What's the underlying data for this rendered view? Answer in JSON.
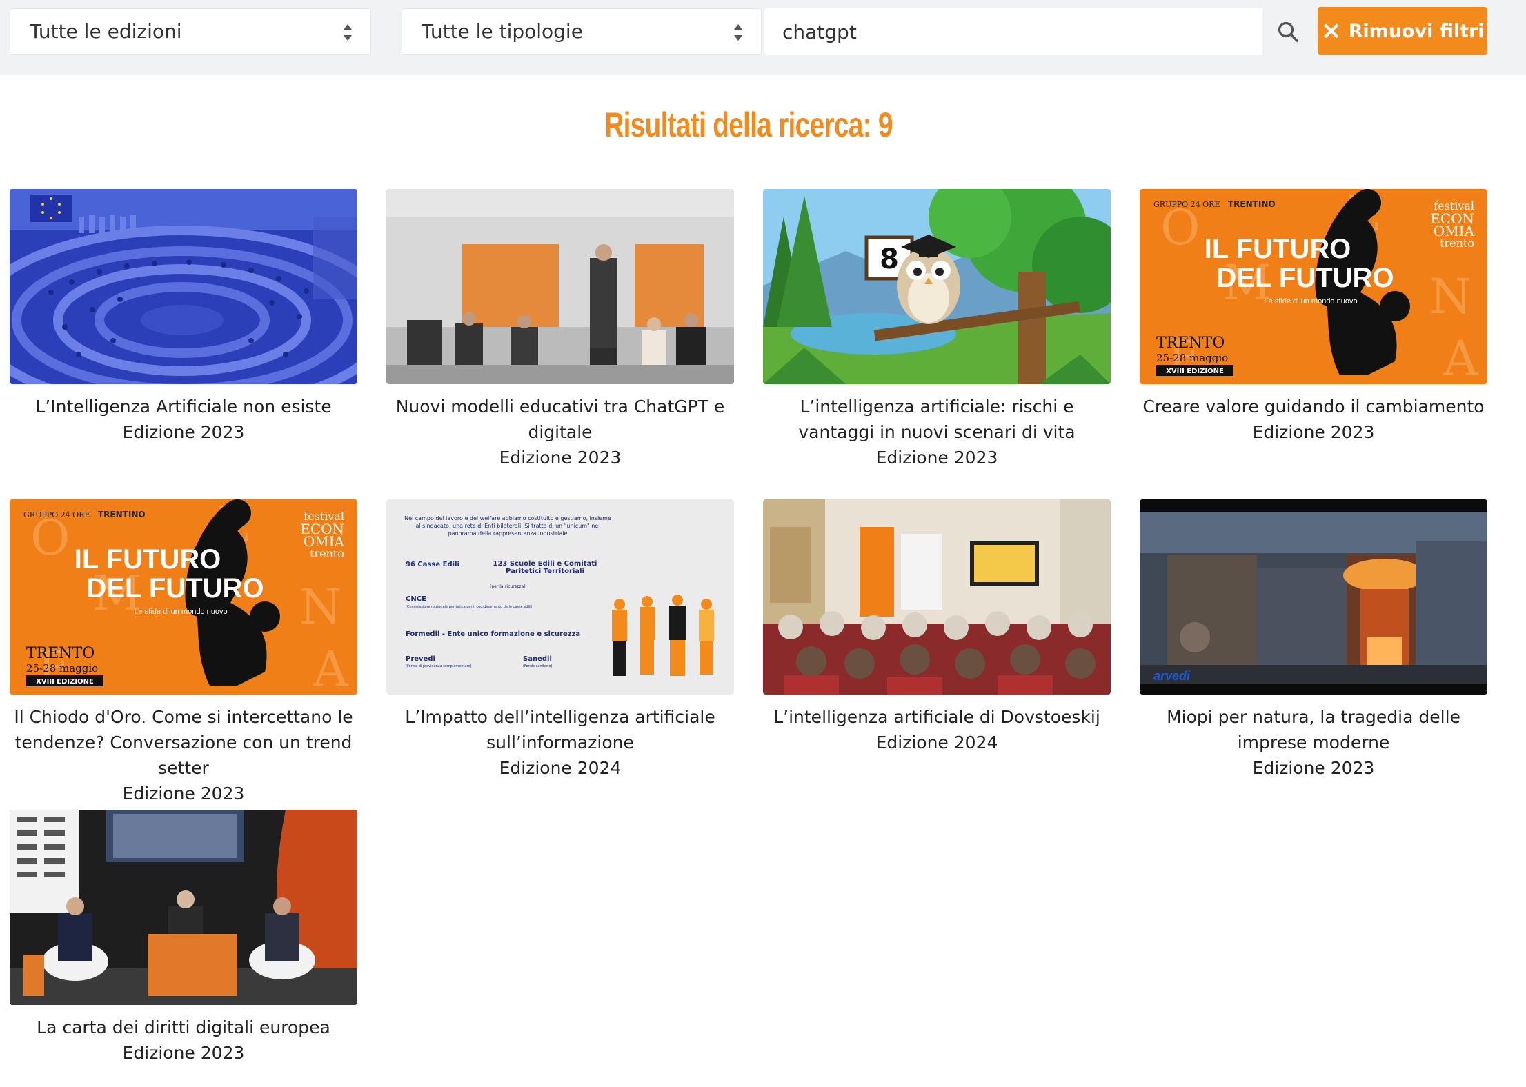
{
  "filters": {
    "edition_select": "Tutte le edizioni",
    "type_select": "Tutte le tipologie",
    "search_value": "chatgpt",
    "remove_label": "Rimuovi filtri",
    "remove_icon": "×"
  },
  "results": {
    "title": "Risultati della ricerca: 9"
  },
  "thumb_text": {
    "festival_lines": [
      "festival",
      "ECON",
      "OMIA",
      "trento"
    ],
    "futuro_line1": "IL FUTURO",
    "futuro_line2": "DEL FUTURO",
    "futuro_sub": "Le sfide di un mondo nuovo",
    "trento": "TRENTO",
    "dates": "25-28 maggio",
    "edizione": "XVIII EDIZIONE",
    "gruppo": "GRUPPO 24 ORE",
    "trentino": "TRENTINO",
    "owl_sign": "8",
    "slide_intro": "Nel campo del lavoro e del welfare abbiamo costituito e gestiamo, insieme al sindacato, una rete di Enti bilaterali. Si tratta di un \"unicum\" nel panorama della rappresentanza industriale",
    "slide_a": "96 Casse Edili",
    "slide_b": "123 Scuole Edili e Comitati Paritetici Territoriali",
    "slide_b_sub": "(per la sicurezza)",
    "slide_c": "CNCE",
    "slide_c_sub": "(Commissione nazionale paritetica per il coordinamento delle casse edili)",
    "slide_d": "Formedil - Ente unico formazione e sicurezza",
    "slide_e": "Prevedi",
    "slide_e_sub": "(Fondo di previdenza complementare)",
    "slide_f": "Sanedil",
    "slide_f_sub": "(Fondo sanitario)",
    "arvedi": "arvedi"
  },
  "cards": [
    {
      "title": "L’Intelligenza Artificiale non esiste",
      "edition": "Edizione 2023"
    },
    {
      "title": "Nuovi modelli educativi tra ChatGPT e digitale",
      "edition": "Edizione 2023"
    },
    {
      "title": "L’intelligenza artificiale: rischi e vantaggi in nuovi scenari di vita",
      "edition": "Edizione 2023"
    },
    {
      "title": "Creare valore guidando il cambiamento",
      "edition": "Edizione 2023"
    },
    {
      "title": "Il Chiodo d'Oro. Come si intercettano le tendenze? Conversazione con un trend setter",
      "edition": "Edizione 2023"
    },
    {
      "title": "L’Impatto dell’intelligenza artificiale sull’informazione",
      "edition": "Edizione 2024"
    },
    {
      "title": "L’intelligenza artificiale di Dovstoeskij",
      "edition": "Edizione 2024"
    },
    {
      "title": "Miopi per natura, la tragedia delle imprese moderne",
      "edition": "Edizione 2023"
    },
    {
      "title": "La carta dei diritti digitali europea",
      "edition": "Edizione 2023"
    }
  ],
  "colors": {
    "accent": "#f28a1c",
    "filterbar": "#f1f2f4"
  }
}
